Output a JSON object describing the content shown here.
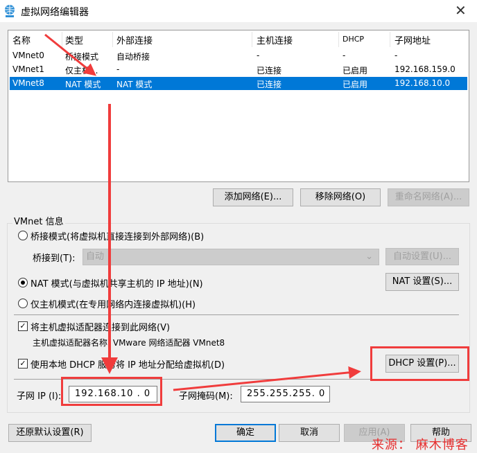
{
  "window": {
    "title": "虚拟网络编辑器",
    "icon": "network-globe-icon"
  },
  "table": {
    "headers": [
      "名称",
      "类型",
      "外部连接",
      "主机连接",
      "DHCP",
      "子网地址"
    ],
    "rows": [
      [
        "VMnet0",
        "桥接模式",
        "自动桥接",
        "-",
        "-",
        "-"
      ],
      [
        "VMnet1",
        "仅主机...",
        "-",
        "已连接",
        "已启用",
        "192.168.159.0"
      ],
      [
        "VMnet8",
        "NAT 模式",
        "NAT 模式",
        "已连接",
        "已启用",
        "192.168.10.0"
      ]
    ],
    "selected_row": 2
  },
  "list_buttons": {
    "add": "添加网络(E)...",
    "remove": "移除网络(O)",
    "rename": "重命名网络(A)..."
  },
  "vmnet_info": {
    "label": "VMnet 信息",
    "bridge_radio": "桥接模式(将虚拟机直接连接到外部网络)(B)",
    "bridge_to_label": "桥接到(T):",
    "bridge_to_value": "自动",
    "auto_settings": "自动设置(U)...",
    "nat_radio": "NAT 模式(与虚拟机共享主机的 IP 地址)(N)",
    "nat_settings": "NAT 设置(S)...",
    "hostonly_radio": "仅主机模式(在专用网络内连接虚拟机)(H)",
    "connect_adapter": "将主机虚拟适配器连接到此网络(V)",
    "adapter_name": "主机虚拟适配器名称: VMware 网络适配器 VMnet8",
    "use_dhcp": "使用本地 DHCP 服务将 IP 地址分配给虚拟机(D)",
    "dhcp_settings": "DHCP 设置(P)...",
    "subnet_ip_label": "子网 IP (I):",
    "subnet_ip": "192.168.10 . 0",
    "subnet_mask_label": "子网掩码(M):",
    "subnet_mask": "255.255.255. 0"
  },
  "footer": {
    "restore": "还原默认设置(R)",
    "ok": "确定",
    "cancel": "取消",
    "apply": "应用(A)",
    "help": "帮助"
  },
  "watermark": "来源： 麻木博客",
  "colors": {
    "selection": "#0078d7",
    "annotation": "#f03c3c"
  }
}
